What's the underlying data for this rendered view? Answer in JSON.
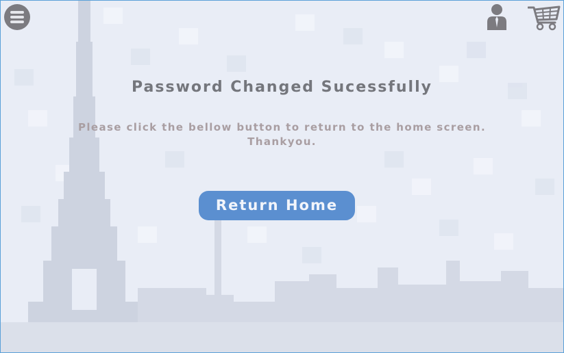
{
  "header": {
    "menu_icon": "hamburger-menu-icon",
    "user_icon": "user-profile-icon",
    "cart_icon": "shopping-cart-icon"
  },
  "main": {
    "title": "Password Changed Sucessfully",
    "message_line1": "Please click the bellow button to return to the home screen.",
    "message_line2": "Thankyou.",
    "return_button_label": "Return Home"
  },
  "colors": {
    "background": "#e9edf6",
    "skyline": "#cfd5e2",
    "button": "#5b8fd0",
    "title_text": "#74767c",
    "message_text": "#a99ea2",
    "icon": "#7c7b80",
    "border": "#5aa0d8"
  }
}
